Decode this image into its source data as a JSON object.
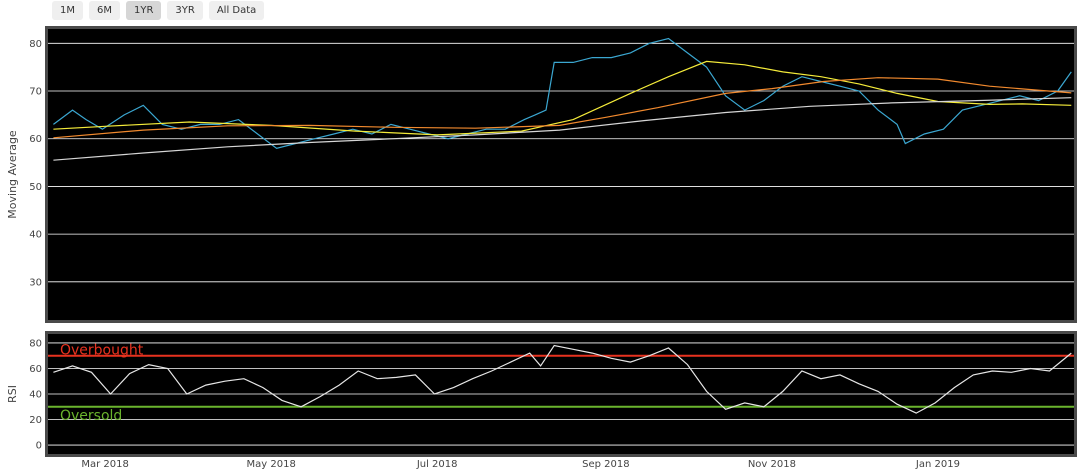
{
  "range_selector": {
    "buttons": [
      {
        "label": "1M",
        "active": false
      },
      {
        "label": "6M",
        "active": false
      },
      {
        "label": "1YR",
        "active": true
      },
      {
        "label": "3YR",
        "active": false
      },
      {
        "label": "All Data",
        "active": false
      }
    ]
  },
  "chart_data": [
    {
      "type": "line",
      "ylabel": "Moving Average",
      "ylim": [
        22,
        83
      ],
      "yticks": [
        30,
        40,
        50,
        60,
        70,
        80
      ],
      "plot_bg": "#000000",
      "grid": true,
      "series": [
        {
          "color": "#3ba7d1",
          "points": [
            [
              "2018-02-10",
              63
            ],
            [
              "2018-02-17",
              66
            ],
            [
              "2018-02-22",
              64
            ],
            [
              "2018-02-28",
              62
            ],
            [
              "2018-03-08",
              65
            ],
            [
              "2018-03-15",
              67
            ],
            [
              "2018-03-22",
              63
            ],
            [
              "2018-03-29",
              62
            ],
            [
              "2018-04-05",
              63
            ],
            [
              "2018-04-12",
              63
            ],
            [
              "2018-04-19",
              64
            ],
            [
              "2018-04-26",
              61
            ],
            [
              "2018-05-03",
              58
            ],
            [
              "2018-05-10",
              59
            ],
            [
              "2018-05-17",
              60
            ],
            [
              "2018-05-24",
              61
            ],
            [
              "2018-05-31",
              62
            ],
            [
              "2018-06-07",
              61
            ],
            [
              "2018-06-14",
              63
            ],
            [
              "2018-06-21",
              62
            ],
            [
              "2018-06-28",
              61
            ],
            [
              "2018-07-05",
              60
            ],
            [
              "2018-07-12",
              61
            ],
            [
              "2018-07-19",
              62
            ],
            [
              "2018-07-26",
              62
            ],
            [
              "2018-08-02",
              64
            ],
            [
              "2018-08-06",
              65
            ],
            [
              "2018-08-10",
              66
            ],
            [
              "2018-08-13",
              76
            ],
            [
              "2018-08-20",
              76
            ],
            [
              "2018-08-27",
              77
            ],
            [
              "2018-09-03",
              77
            ],
            [
              "2018-09-10",
              78
            ],
            [
              "2018-09-17",
              80
            ],
            [
              "2018-09-24",
              81
            ],
            [
              "2018-10-01",
              78
            ],
            [
              "2018-10-08",
              75
            ],
            [
              "2018-10-15",
              69
            ],
            [
              "2018-10-22",
              66
            ],
            [
              "2018-10-29",
              68
            ],
            [
              "2018-11-05",
              71
            ],
            [
              "2018-11-12",
              73
            ],
            [
              "2018-11-19",
              72
            ],
            [
              "2018-11-26",
              71
            ],
            [
              "2018-12-03",
              70
            ],
            [
              "2018-12-10",
              66
            ],
            [
              "2018-12-17",
              63
            ],
            [
              "2018-12-20",
              59
            ],
            [
              "2018-12-27",
              61
            ],
            [
              "2019-01-03",
              62
            ],
            [
              "2019-01-10",
              66
            ],
            [
              "2019-01-17",
              67
            ],
            [
              "2019-01-24",
              68
            ],
            [
              "2019-01-31",
              69
            ],
            [
              "2019-02-07",
              68
            ],
            [
              "2019-02-14",
              70
            ],
            [
              "2019-02-19",
              74
            ]
          ]
        },
        {
          "color": "#f5ec3a",
          "points": [
            [
              "2018-02-10",
              62
            ],
            [
              "2018-03-01",
              62.6
            ],
            [
              "2018-04-01",
              63.5
            ],
            [
              "2018-05-01",
              62.8
            ],
            [
              "2018-06-01",
              61.6
            ],
            [
              "2018-07-01",
              60.8
            ],
            [
              "2018-08-01",
              61.6
            ],
            [
              "2018-08-20",
              64
            ],
            [
              "2018-09-10",
              69.5
            ],
            [
              "2018-09-24",
              73
            ],
            [
              "2018-10-08",
              76.2
            ],
            [
              "2018-10-22",
              75.5
            ],
            [
              "2018-11-05",
              74
            ],
            [
              "2018-11-19",
              73
            ],
            [
              "2018-12-03",
              71.5
            ],
            [
              "2018-12-17",
              69.5
            ],
            [
              "2019-01-01",
              67.8
            ],
            [
              "2019-01-20",
              67.2
            ],
            [
              "2019-02-01",
              67.3
            ],
            [
              "2019-02-19",
              67
            ]
          ]
        },
        {
          "color": "#f28a2e",
          "points": [
            [
              "2018-02-10",
              60.2
            ],
            [
              "2018-03-15",
              61.8
            ],
            [
              "2018-04-15",
              62.7
            ],
            [
              "2018-05-15",
              62.8
            ],
            [
              "2018-06-15",
              62.4
            ],
            [
              "2018-07-15",
              62.2
            ],
            [
              "2018-08-15",
              62.8
            ],
            [
              "2018-09-01",
              64.5
            ],
            [
              "2018-09-20",
              66.5
            ],
            [
              "2018-10-15",
              69.5
            ],
            [
              "2018-11-01",
              70.5
            ],
            [
              "2018-11-20",
              72
            ],
            [
              "2018-12-10",
              72.8
            ],
            [
              "2019-01-01",
              72.5
            ],
            [
              "2019-01-20",
              71
            ],
            [
              "2019-02-19",
              69.6
            ]
          ]
        },
        {
          "color": "#d6d6d6",
          "points": [
            [
              "2018-02-10",
              55.5
            ],
            [
              "2018-03-15",
              57
            ],
            [
              "2018-04-15",
              58.3
            ],
            [
              "2018-05-15",
              59.2
            ],
            [
              "2018-06-15",
              60
            ],
            [
              "2018-07-15",
              60.8
            ],
            [
              "2018-08-15",
              61.8
            ],
            [
              "2018-09-15",
              63.8
            ],
            [
              "2018-10-15",
              65.5
            ],
            [
              "2018-11-15",
              66.8
            ],
            [
              "2018-12-15",
              67.5
            ],
            [
              "2019-01-15",
              68
            ],
            [
              "2019-02-19",
              68.6
            ]
          ]
        }
      ]
    },
    {
      "type": "line",
      "ylabel": "RSI",
      "ylim": [
        -7,
        87
      ],
      "yticks": [
        0,
        20,
        40,
        60,
        80
      ],
      "plot_bg": "#000000",
      "grid": true,
      "x_ticks": [
        "Mar 2018",
        "May 2018",
        "Jul 2018",
        "Sep 2018",
        "Nov 2018",
        "Jan 2019"
      ],
      "reference_lines": [
        {
          "label": "Overbought",
          "y": 70,
          "color": "#e8321f"
        },
        {
          "label": "Oversold",
          "y": 30,
          "color": "#6ab42d"
        }
      ],
      "series": [
        {
          "color": "#e6e6e6",
          "points": [
            [
              "2018-02-10",
              57
            ],
            [
              "2018-02-17",
              62
            ],
            [
              "2018-02-24",
              57
            ],
            [
              "2018-03-03",
              40
            ],
            [
              "2018-03-10",
              56
            ],
            [
              "2018-03-17",
              63
            ],
            [
              "2018-03-24",
              60
            ],
            [
              "2018-03-31",
              40
            ],
            [
              "2018-04-07",
              47
            ],
            [
              "2018-04-14",
              50
            ],
            [
              "2018-04-21",
              52
            ],
            [
              "2018-04-28",
              45
            ],
            [
              "2018-05-05",
              35
            ],
            [
              "2018-05-12",
              30
            ],
            [
              "2018-05-19",
              38
            ],
            [
              "2018-05-26",
              47
            ],
            [
              "2018-06-02",
              58
            ],
            [
              "2018-06-09",
              52
            ],
            [
              "2018-06-16",
              53
            ],
            [
              "2018-06-23",
              55
            ],
            [
              "2018-06-30",
              40
            ],
            [
              "2018-07-07",
              45
            ],
            [
              "2018-07-14",
              52
            ],
            [
              "2018-07-21",
              58
            ],
            [
              "2018-07-28",
              65
            ],
            [
              "2018-08-04",
              72
            ],
            [
              "2018-08-08",
              62
            ],
            [
              "2018-08-13",
              78
            ],
            [
              "2018-08-20",
              75
            ],
            [
              "2018-08-27",
              72
            ],
            [
              "2018-09-03",
              68
            ],
            [
              "2018-09-10",
              65
            ],
            [
              "2018-09-17",
              70
            ],
            [
              "2018-09-24",
              76
            ],
            [
              "2018-10-01",
              63
            ],
            [
              "2018-10-08",
              42
            ],
            [
              "2018-10-15",
              28
            ],
            [
              "2018-10-22",
              33
            ],
            [
              "2018-10-29",
              30
            ],
            [
              "2018-11-05",
              42
            ],
            [
              "2018-11-12",
              58
            ],
            [
              "2018-11-19",
              52
            ],
            [
              "2018-11-26",
              55
            ],
            [
              "2018-12-03",
              48
            ],
            [
              "2018-12-10",
              42
            ],
            [
              "2018-12-17",
              32
            ],
            [
              "2018-12-24",
              25
            ],
            [
              "2018-12-31",
              33
            ],
            [
              "2019-01-07",
              45
            ],
            [
              "2019-01-14",
              55
            ],
            [
              "2019-01-21",
              58
            ],
            [
              "2019-01-28",
              57
            ],
            [
              "2019-02-04",
              60
            ],
            [
              "2019-02-11",
              58
            ],
            [
              "2019-02-19",
              72
            ]
          ]
        }
      ]
    }
  ]
}
